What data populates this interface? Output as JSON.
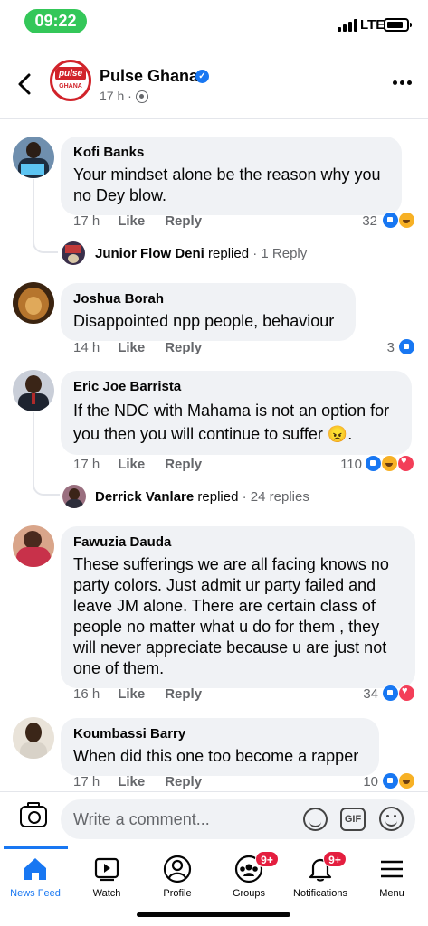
{
  "status_bar": {
    "time": "09:22",
    "network": "LTE"
  },
  "header": {
    "page_name": "Pulse Ghana",
    "logo_text": "pulse",
    "logo_subtext": "GHANA",
    "time_ago": "17 h ·"
  },
  "comments": [
    {
      "author": "Kofi Banks",
      "text": "Your mindset alone be the reason why you no Dey blow.",
      "time": "17 h",
      "like": "Like",
      "reply": "Reply",
      "reaction_count": "32",
      "reactions": [
        "like-icon",
        "haha-icon"
      ],
      "reply_summary": {
        "name": "Junior Flow Deni",
        "verb": "replied",
        "count": "· 1 Reply"
      }
    },
    {
      "author": "Joshua Borah",
      "text": "Disappointed npp people, behaviour",
      "time": "14 h",
      "like": "Like",
      "reply": "Reply",
      "reaction_count": "3",
      "reactions": [
        "like-icon"
      ]
    },
    {
      "author": "Eric Joe Barrista",
      "text": "If the NDC with Mahama is not an option for you then you will continue to suffer 😠.",
      "time": "17 h",
      "like": "Like",
      "reply": "Reply",
      "reaction_count": "110",
      "reactions": [
        "like-icon",
        "haha-icon",
        "love-icon"
      ],
      "reply_summary": {
        "name": "Derrick Vanlare",
        "verb": "replied",
        "count": "· 24 replies"
      }
    },
    {
      "author": "Fawuzia Dauda",
      "text": "These  sufferings we are all facing knows no party colors. Just admit ur  party failed and leave JM alone. There are certain class of people no matter what u do for them , they will never appreciate because u are just not one of them.",
      "time": "16 h",
      "like": "Like",
      "reply": "Reply",
      "reaction_count": "34",
      "reactions": [
        "like-icon",
        "love-icon"
      ]
    },
    {
      "author": "Koumbassi Barry",
      "text": "When did this one too become a rapper",
      "time": "17 h",
      "like": "Like",
      "reply": "Reply",
      "reaction_count": "10",
      "reactions": [
        "like-icon",
        "haha-icon"
      ]
    }
  ],
  "composer": {
    "placeholder": "Write a comment...",
    "gif_label": "GIF"
  },
  "tabbar": {
    "tabs": [
      {
        "label": "News Feed",
        "icon": "home-icon",
        "active": true
      },
      {
        "label": "Watch",
        "icon": "watch-icon"
      },
      {
        "label": "Profile",
        "icon": "profile-icon"
      },
      {
        "label": "Groups",
        "icon": "groups-icon",
        "badge": "9+"
      },
      {
        "label": "Notifications",
        "icon": "bell-icon",
        "badge": "9+"
      },
      {
        "label": "Menu",
        "icon": "menu-icon"
      }
    ]
  },
  "colors": {
    "accent": "#1877f2",
    "badge": "#e41e3f",
    "bubble": "#f0f2f5",
    "status_pill": "#34c759"
  }
}
